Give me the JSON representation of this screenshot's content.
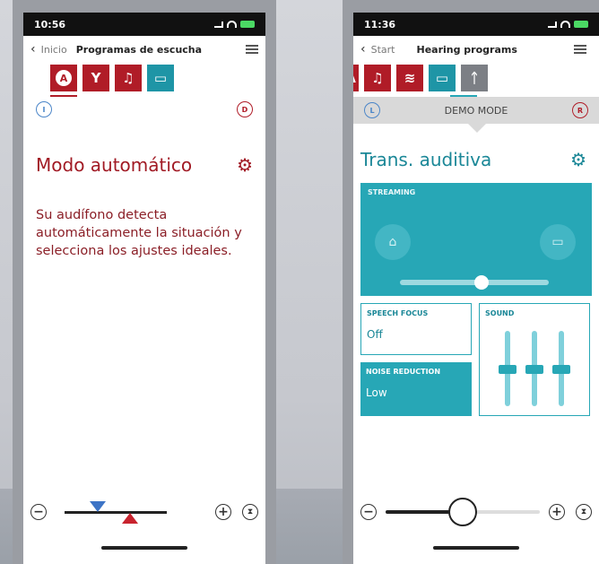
{
  "left": {
    "status_time": "10:56",
    "nav_back_label": "Inicio",
    "nav_title": "Programas de escucha",
    "tabs": [
      {
        "icon": "auto-a-icon",
        "glyph": "A"
      },
      {
        "icon": "cocktail-icon",
        "glyph": "Y"
      },
      {
        "icon": "music-note-icon",
        "glyph": "♫"
      },
      {
        "icon": "tv-icon",
        "glyph": "▭"
      }
    ],
    "left_indicator": "I",
    "right_indicator": "D",
    "program_title": "Modo automático",
    "program_description": "Su audífono detecta automáticamente la situación y selecciona los ajustes ideales."
  },
  "right": {
    "status_time": "11:36",
    "nav_back_label": "Start",
    "nav_title": "Hearing programs",
    "tabs": [
      {
        "icon": "auto-a-icon",
        "glyph": "A"
      },
      {
        "icon": "music-note-icon",
        "glyph": "♫"
      },
      {
        "icon": "noise-waves-icon",
        "glyph": "≋"
      },
      {
        "icon": "tv-icon",
        "glyph": "▭"
      },
      {
        "icon": "restaurant-icon",
        "glyph": "ᛏ"
      }
    ],
    "left_indicator": "L",
    "right_indicator": "R",
    "demo_label": "DEMO MODE",
    "program_title": "Trans. auditiva",
    "streaming_label": "STREAMING",
    "streaming_balance": 0.55,
    "speech_focus_label": "SPEECH FOCUS",
    "speech_focus_value": "Off",
    "noise_reduction_label": "NOISE REDUCTION",
    "noise_reduction_value": "Low",
    "sound_label": "SOUND",
    "volume_level": 0.5
  },
  "colors": {
    "brand_red": "#b01c27",
    "teal": "#27a7b6"
  }
}
